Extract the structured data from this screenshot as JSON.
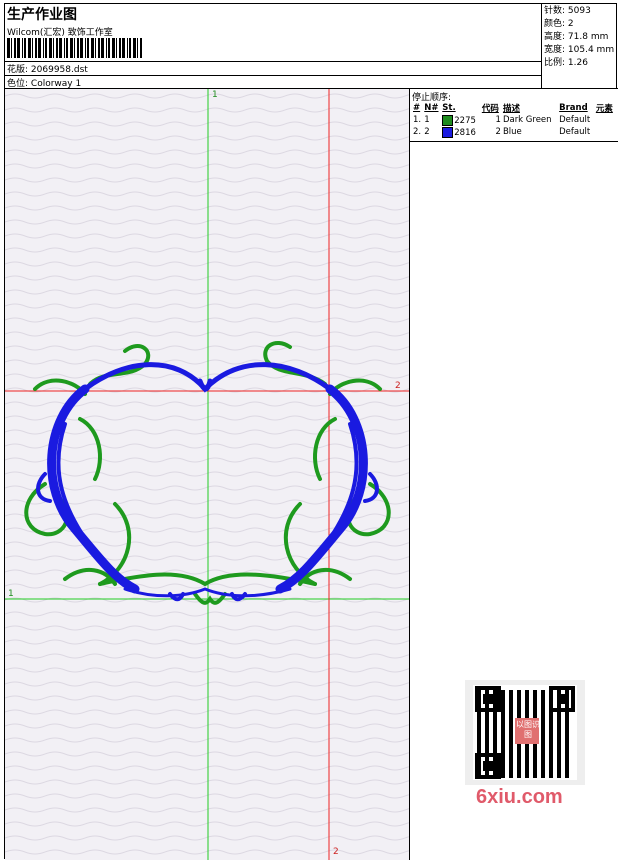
{
  "header": {
    "title": "生产作业图",
    "studio": "Wilcom(汇宏) 致饰工作室",
    "file_label": "花版:",
    "file_name": "2069958.dst",
    "color_label": "色位:",
    "colorway": "Colorway 1"
  },
  "stats": [
    {
      "label": "针数:",
      "value": "5093"
    },
    {
      "label": "颜色:",
      "value": "2"
    },
    {
      "label": "高度:",
      "value": "71.8 mm"
    },
    {
      "label": "宽度:",
      "value": "105.4 mm"
    },
    {
      "label": "比例:",
      "value": "1.26"
    }
  ],
  "stop_panel": {
    "title": "停止顺序:",
    "columns": [
      "#",
      "N#",
      "St.",
      "代码",
      "描述",
      "Brand",
      "元素"
    ],
    "rows": [
      {
        "n": "1.",
        "num": "1",
        "color": "#1e8c1e",
        "stitches": "2275",
        "code": "1",
        "description": "Dark Green",
        "brand": "Default"
      },
      {
        "n": "2.",
        "num": "2",
        "color": "#1a1ae0",
        "stitches": "2816",
        "code": "2",
        "description": "Blue",
        "brand": "Default"
      }
    ]
  },
  "canvas": {
    "guide_green_label_x": "1",
    "guide_green_label_y": "1",
    "guide_red_label_x": "2",
    "guide_red_label_y": "2",
    "green_color": "#22cc22",
    "red_color": "#ee2222",
    "design_green": "#1e9a1e",
    "design_blue": "#1a1ae0"
  },
  "watermark": {
    "text": "6xiu.com",
    "badge": "以图识图"
  }
}
